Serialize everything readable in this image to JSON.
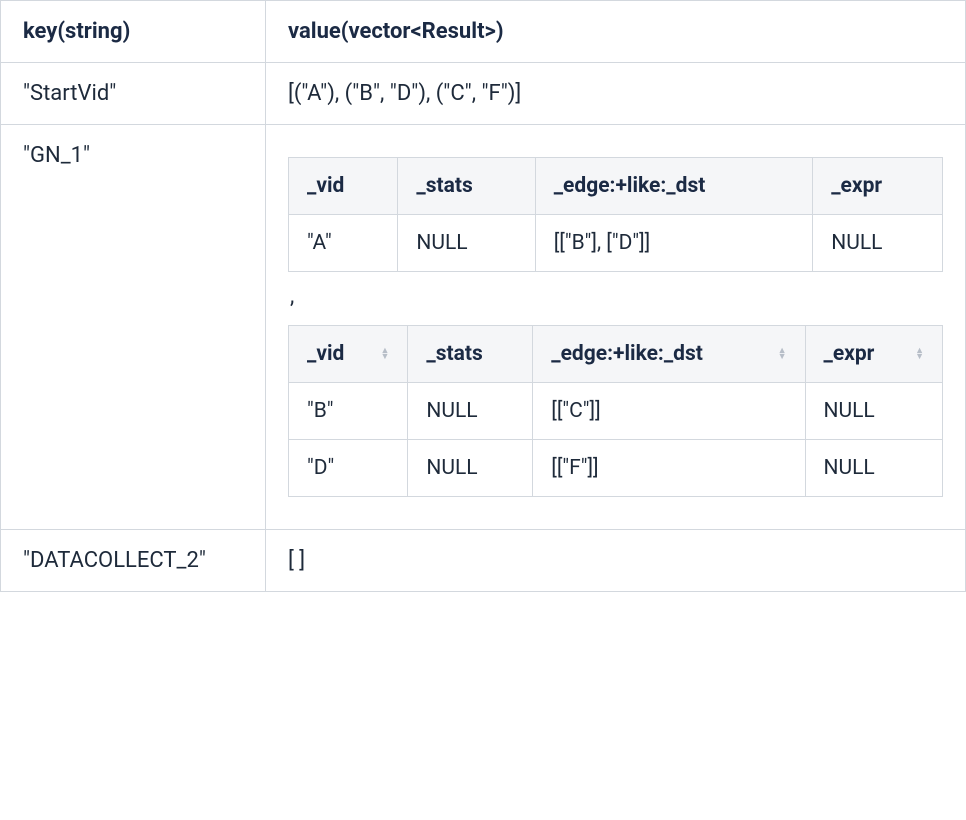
{
  "table": {
    "headers": {
      "key": "key(string)",
      "value": "value(vector<Result>)"
    },
    "rows": {
      "startvid": {
        "key": "\"StartVid\"",
        "value": "[(\"A\"),  (\"B\", \"D\"), (\"C\", \"F\")]"
      },
      "gn1": {
        "key": "\"GN_1\"",
        "separator": ",",
        "inner_headers": {
          "vid": "_vid",
          "stats": "_stats",
          "edge": "_edge:+like:_dst",
          "expr": "_expr"
        },
        "t1": {
          "r0": {
            "vid": "\"A\"",
            "stats": "NULL",
            "edge": "[[\"B\"], [\"D\"]]",
            "expr": "NULL"
          }
        },
        "t2": {
          "r0": {
            "vid": "\"B\"",
            "stats": "NULL",
            "edge": "[[\"C\"]]",
            "expr": "NULL"
          },
          "r1": {
            "vid": "\"D\"",
            "stats": "NULL",
            "edge": "[[\"F\"]]",
            "expr": "NULL"
          }
        }
      },
      "datacollect": {
        "key": "\"DATACOLLECT_2\"",
        "value": "[ ]"
      }
    }
  }
}
